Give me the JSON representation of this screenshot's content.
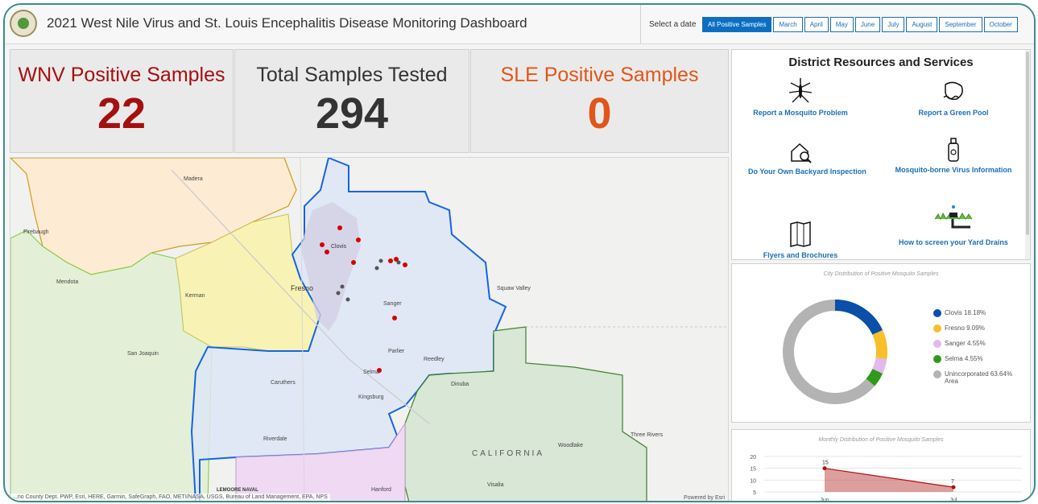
{
  "header": {
    "title": "2021 West Nile Virus and St. Louis Encephalitis Disease Monitoring Dashboard",
    "date_label": "Select a date",
    "tabs": [
      "All Positive Samples",
      "March",
      "April",
      "May",
      "June",
      "July",
      "August",
      "September",
      "October"
    ],
    "active_tab": "All Positive Samples"
  },
  "stats": {
    "wnv": {
      "label": "WNV Positive Samples",
      "value": "22",
      "color": "#a50f0f"
    },
    "total": {
      "label": "Total Samples Tested",
      "value": "294",
      "color": "#333333"
    },
    "sle": {
      "label": "SLE Positive Samples",
      "value": "0",
      "color": "#e0561a"
    }
  },
  "map": {
    "places": [
      "Madera",
      "Firebaugh",
      "Clovis",
      "Fresno",
      "Mendota",
      "Kerman",
      "Sanger",
      "Squaw Valley",
      "San Joaquin",
      "Parlier",
      "Reedley",
      "Selma",
      "Caruthers",
      "Kingsburg",
      "Dinuba",
      "Riverdale",
      "CALIFORNIA",
      "Woodlake",
      "Three Rivers",
      "LEMOORE NAVAL",
      "Hanford",
      "Visalia"
    ],
    "attribution": "...no County Dept. PWP, Esri, HERE, Garmin, SafeGraph, FAO, METI/NASA, USGS, Bureau of Land Management, EPA, NPS",
    "powered_by": "Powered by Esri"
  },
  "resources": {
    "title": "District Resources and Services",
    "items": [
      {
        "label": "Report a Mosquito Problem",
        "icon": "mosquito-icon"
      },
      {
        "label": "Report a Green Pool",
        "icon": "pool-icon"
      },
      {
        "label": "Do Your Own Backyard Inspection",
        "icon": "house-inspection-icon"
      },
      {
        "label": "Mosquito-borne Virus Information",
        "icon": "spray-bottle-icon"
      },
      {
        "label": "Flyers and Brochures",
        "icon": "brochure-icon"
      },
      {
        "label": "How to screen your Yard Drains",
        "icon": "yard-drain-icon"
      }
    ]
  },
  "city_chart": {
    "title": "City Distribution of Positive Mosquito Samples",
    "legend": [
      {
        "label": "Clovis 18.18%",
        "color": "#0a4fa8"
      },
      {
        "label": "Fresno 9.09%",
        "color": "#f5c02a"
      },
      {
        "label": "Sanger 4.55%",
        "color": "#e2b9ee"
      },
      {
        "label": "Selma 4.55%",
        "color": "#2f9a1a"
      },
      {
        "label": "Unincorporated 63.64% Area",
        "color": "#b3b3b3"
      }
    ]
  },
  "monthly_chart": {
    "title": "Monthly Distribution of Positive Mosquito Samples"
  },
  "chart_data": [
    {
      "type": "pie",
      "title": "City Distribution of Positive Mosquito Samples",
      "categories": [
        "Clovis",
        "Fresno",
        "Sanger",
        "Selma",
        "Unincorporated Area"
      ],
      "values": [
        18.18,
        9.09,
        4.55,
        4.55,
        63.64
      ],
      "colors": [
        "#0a4fa8",
        "#f5c02a",
        "#e2b9ee",
        "#2f9a1a",
        "#b3b3b3"
      ],
      "legend": "right"
    },
    {
      "type": "area",
      "title": "Monthly Distribution of Positive Mosquito Samples",
      "categories": [
        "Jun",
        "Jul"
      ],
      "series": [
        {
          "values": [
            15,
            7
          ]
        }
      ],
      "yticks": [
        5,
        10,
        15,
        20
      ],
      "ylim": [
        5,
        20
      ],
      "grid": true,
      "color": "#c0504d"
    }
  ]
}
